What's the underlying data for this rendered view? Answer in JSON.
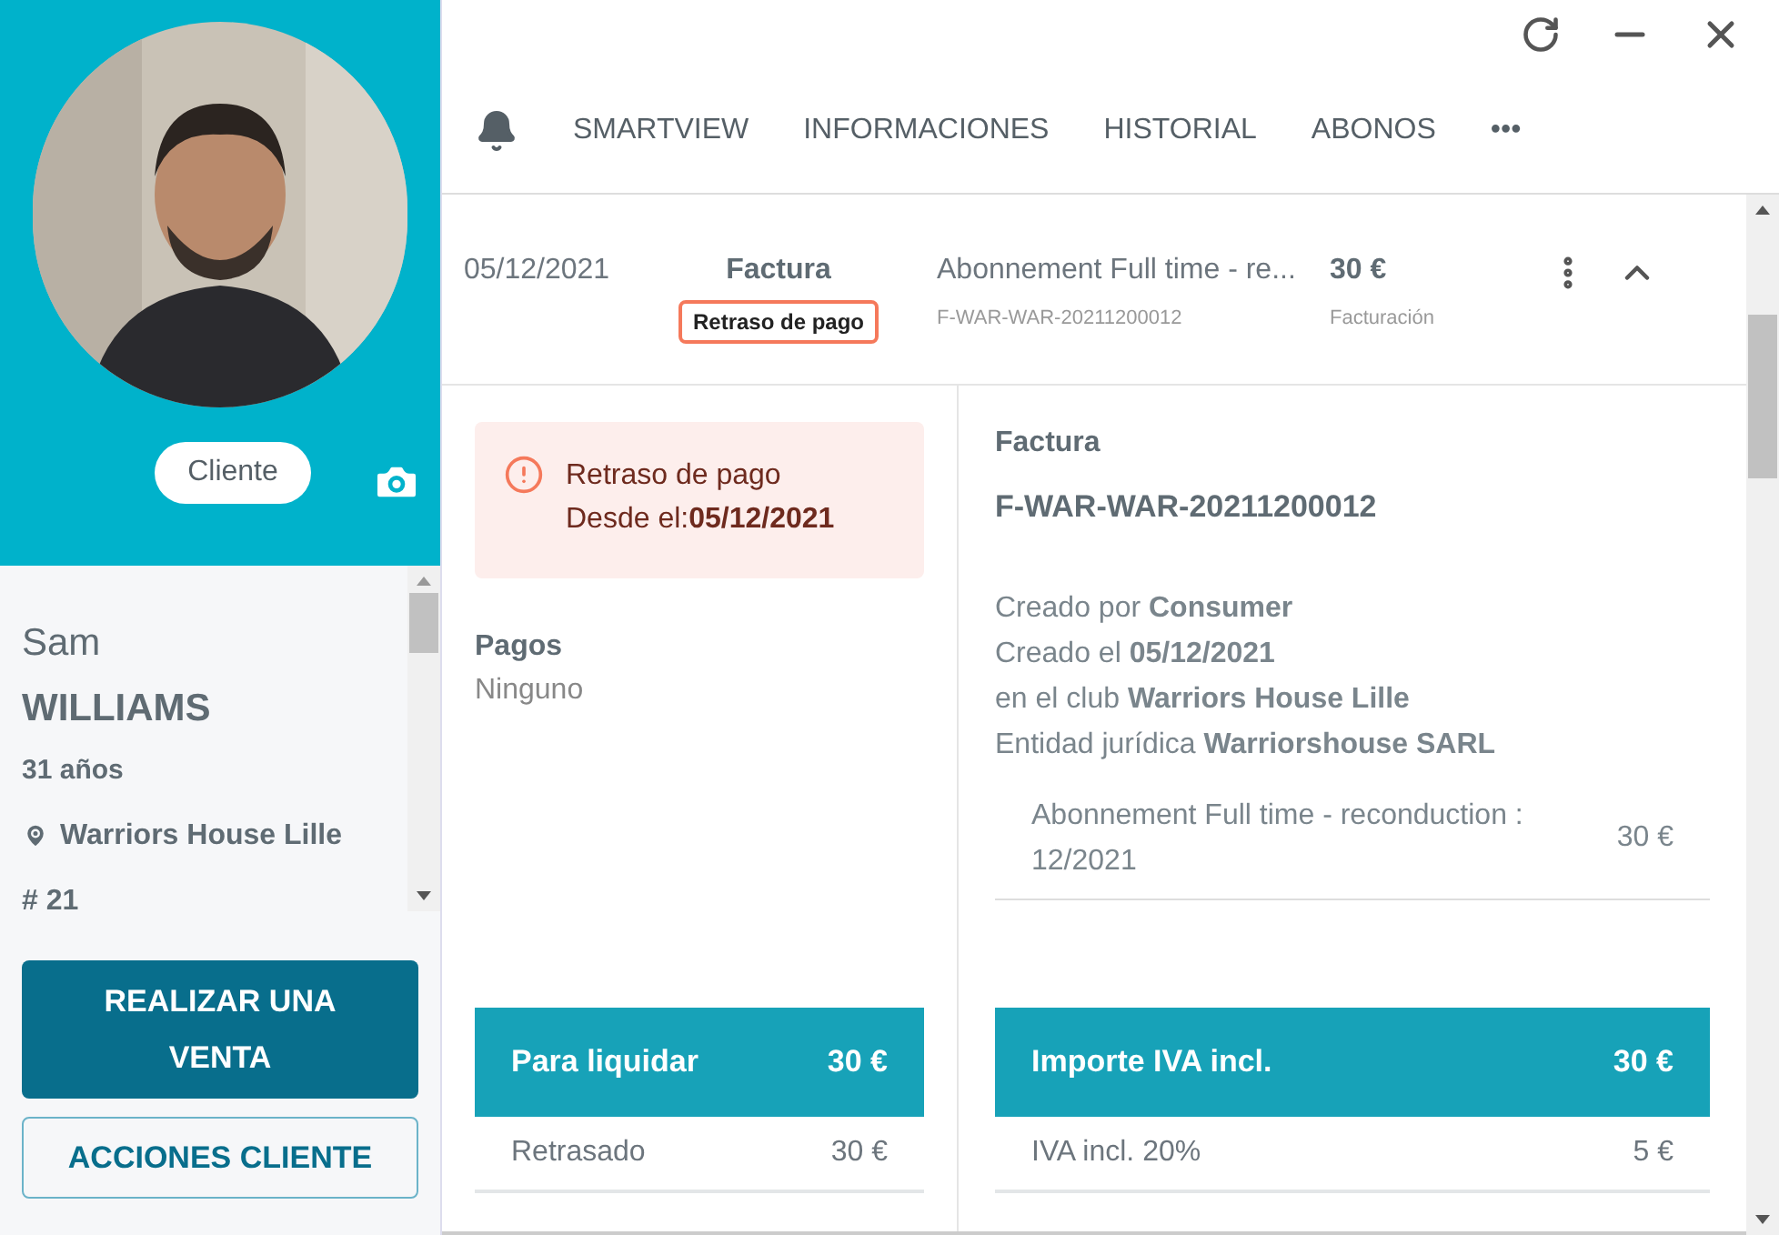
{
  "profile": {
    "badge": "Cliente",
    "first_name": "Sam",
    "last_name": "WILLIAMS",
    "age": "31 años",
    "club": "Warriors House Lille",
    "number": "# 21"
  },
  "actions": [
    "REALIZAR UNA VENTA",
    "ACCIONES CLIENTE"
  ],
  "tabs": [
    "SMARTVIEW",
    "INFORMACIONES",
    "HISTORIAL",
    "ABONOS",
    "•••"
  ],
  "invoice_row": {
    "date": "05/12/2021",
    "type": "Factura",
    "status": "Retraso de pago",
    "description": "Abonnement Full time - re...",
    "reference": "F-WAR-WAR-20211200012",
    "amount": "30 €",
    "category": "Facturación",
    "expanded": true
  },
  "alert": {
    "title": "Retraso de pago",
    "since": "Desde el:**05/12/2021**"
  },
  "payments": {
    "label": "Pagos",
    "value": "Ninguno"
  },
  "details": {
    "title": "Factura",
    "reference": "F-WAR-WAR-20211200012",
    "lines": [
      "Creado por **Consumer**",
      "Creado el **05/12/2021**",
      "en el club **Warriors House Lille**",
      "Entidad jurídica **Warriorshouse SARL**"
    ]
  },
  "items": [
    {
      "label": "Abonnement Full time - reconduction : 12/2021",
      "amount": "30 €"
    }
  ],
  "left_total": {
    "label": "Para liquidar",
    "amount": "30 €",
    "rows": [
      {
        "label": "Retrasado",
        "amount": "30 €"
      }
    ]
  },
  "right_total": {
    "label": "Importe IVA incl.",
    "amount": "30 €",
    "rows": [
      {
        "label": "IVA incl. 20%",
        "amount": "5 €"
      }
    ]
  }
}
